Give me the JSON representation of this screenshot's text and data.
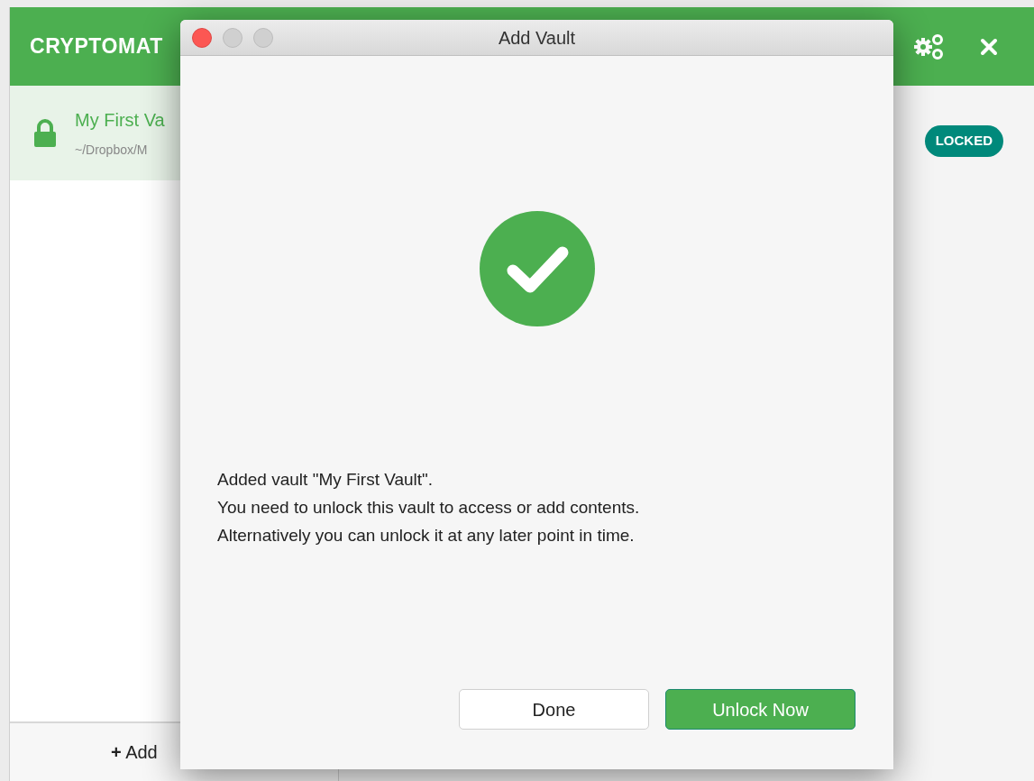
{
  "app": {
    "title": "CRYPTOMAT",
    "badge": "LOCKED"
  },
  "vaults": [
    {
      "name": "My First Va",
      "path": "~/Dropbox/M",
      "selected": true,
      "locked": true
    }
  ],
  "sidebar_footer": {
    "add_label": "Add",
    "add_icon": "+"
  },
  "dialog": {
    "title": "Add Vault",
    "lines": [
      "Added vault \"My First Vault\".",
      "You need to unlock this vault to access or add contents.",
      "Alternatively you can unlock it at any later point in time."
    ],
    "buttons": [
      {
        "label": "Done",
        "kind": "secondary"
      },
      {
        "label": "Unlock Now",
        "kind": "primary"
      }
    ]
  }
}
